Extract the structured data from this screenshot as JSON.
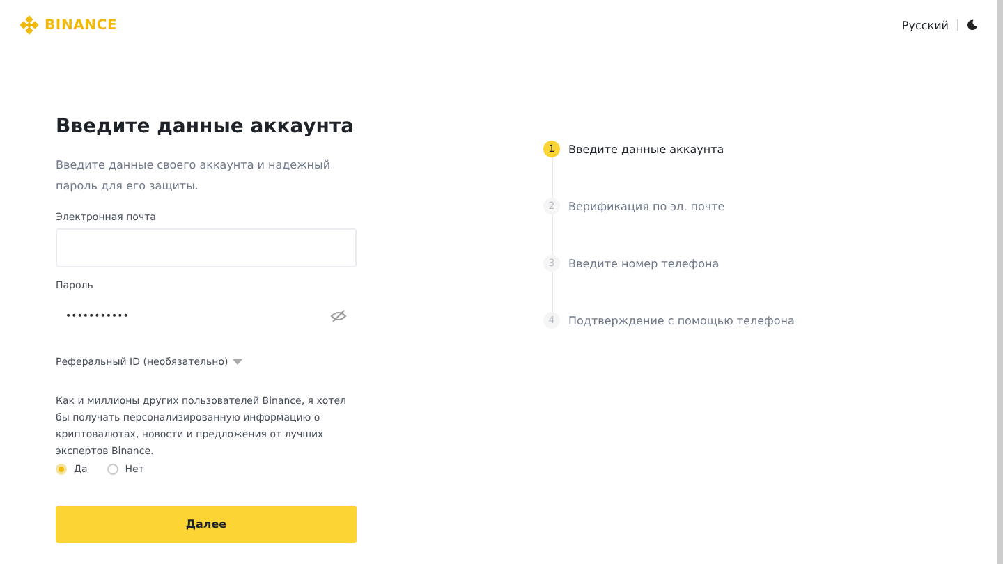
{
  "header": {
    "logo": "BINANCE",
    "language": "Русский"
  },
  "form": {
    "title": "Введите данные аккаунта",
    "subtitle": "Введите данные своего аккаунта и надежный пароль для его защиты.",
    "fields": [
      {
        "label": "Электронная почта",
        "kind": "text"
      },
      {
        "label": "Пароль",
        "kind": "password",
        "value": "•••••••••••"
      }
    ],
    "referral": "Реферальный ID (необязательно)",
    "consent": "Как и миллионы других пользователей Binance, я хотел бы получать персонализированную информацию о криптовалютах, новости и предложения от лучших экспертов Binance.",
    "options": [
      {
        "label": "Да",
        "selected": true
      },
      {
        "label": "Нет",
        "selected": false
      }
    ],
    "submit": "Далее"
  },
  "steps": [
    {
      "number": "1",
      "label": "Введите данные аккаунта",
      "selected": true
    },
    {
      "number": "2",
      "label": "Верификация по эл. почте",
      "selected": false
    },
    {
      "number": "3",
      "label": "Введите номер телефона",
      "selected": false
    },
    {
      "number": "4",
      "label": "Подтверждение с помощью телефона",
      "selected": false
    }
  ]
}
